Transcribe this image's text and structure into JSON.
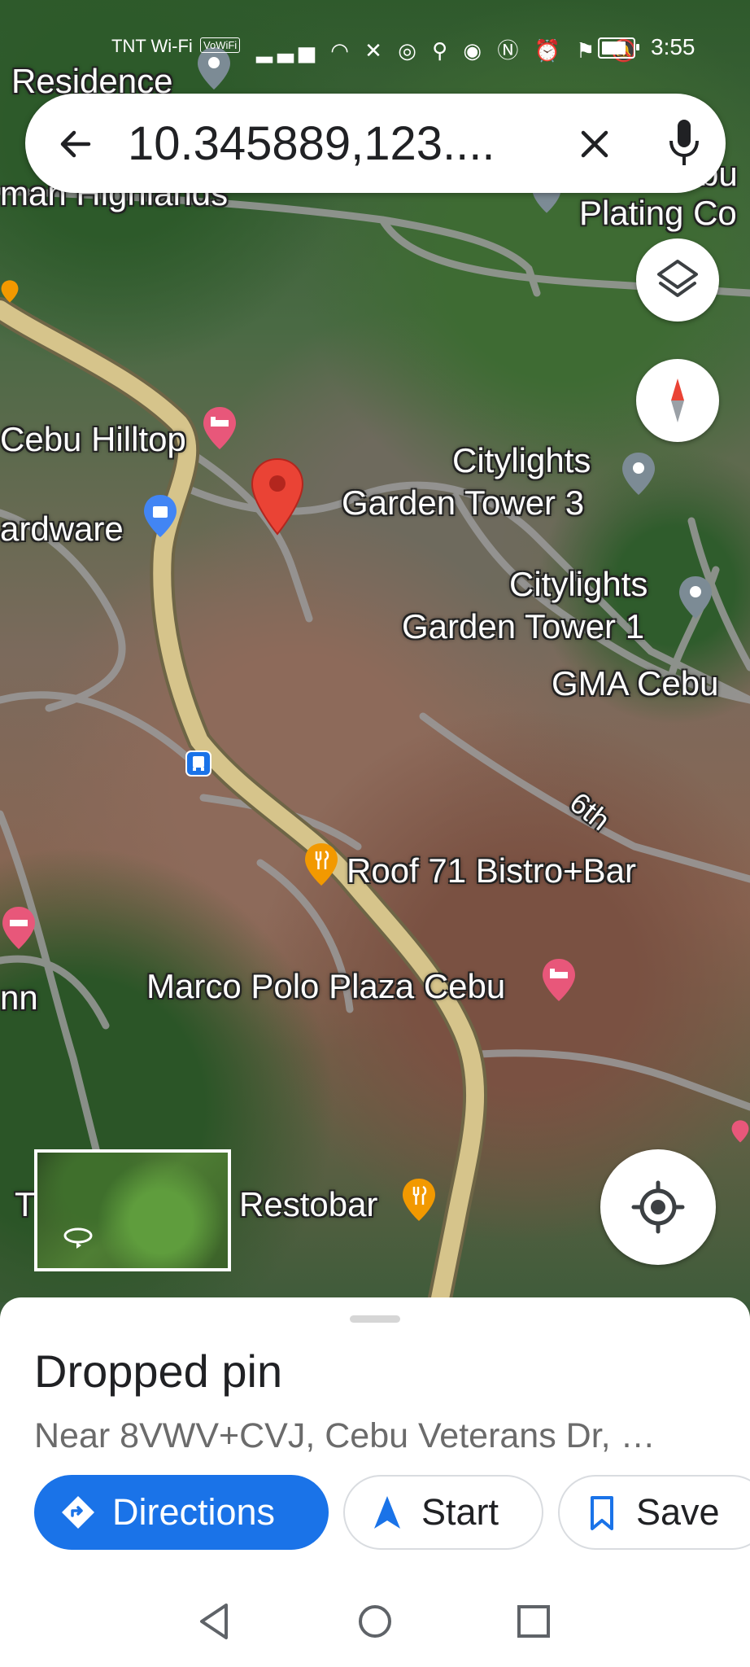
{
  "status_bar": {
    "carrier": "TNT Wi-Fi",
    "volte_badge": "VoWiFi",
    "time": "3:55",
    "icons": [
      "signal-icon",
      "wifi-icon",
      "missed-call-icon",
      "messenger-icon",
      "person-icon",
      "eye-icon",
      "nfc-icon",
      "alarm-icon",
      "location-icon",
      "mute-icon"
    ],
    "battery_level": 0.85
  },
  "search": {
    "query": "10.345889,123....",
    "back_icon": "arrow-back-icon",
    "clear_icon": "close-icon",
    "mic_icon": "mic-icon"
  },
  "map": {
    "labels": {
      "residence": "Residence",
      "highlands": "man Highlands",
      "plating": "Plating Co",
      "plating_top": "bu",
      "cebu_hilltop": "Cebu Hilltop",
      "hardware": "ardware",
      "citylights3_a": "Citylights",
      "citylights3_b": "Garden Tower 3",
      "citylights1_a": "Citylights",
      "citylights1_b": "Garden Tower 1",
      "gma": "GMA Cebu",
      "sixth": "6th",
      "roof71": "Roof 71 Bistro+Bar",
      "marco_polo": "Marco Polo Plaza Cebu",
      "inn": "nn",
      "t": "T",
      "restobar": "Restobar"
    },
    "controls": {
      "layers": "layers-icon",
      "compass": "compass-icon",
      "my_location": "my-location-icon"
    },
    "colors": {
      "pin_red": "#ea4335",
      "hotel_pink": "#e8577a",
      "shop_blue": "#4285f4",
      "food_orange": "#f29900",
      "landmark_gray": "#7c8b95",
      "main_road": "#d6c48b"
    }
  },
  "sheet": {
    "title": "Dropped pin",
    "subtitle": "Near 8VWV+CVJ, Cebu Veterans Dr, …",
    "buttons": {
      "directions": "Directions",
      "start": "Start",
      "save": "Save"
    }
  },
  "nav": {
    "back": "nav-back-icon",
    "home": "nav-home-icon",
    "recents": "nav-recents-icon"
  }
}
